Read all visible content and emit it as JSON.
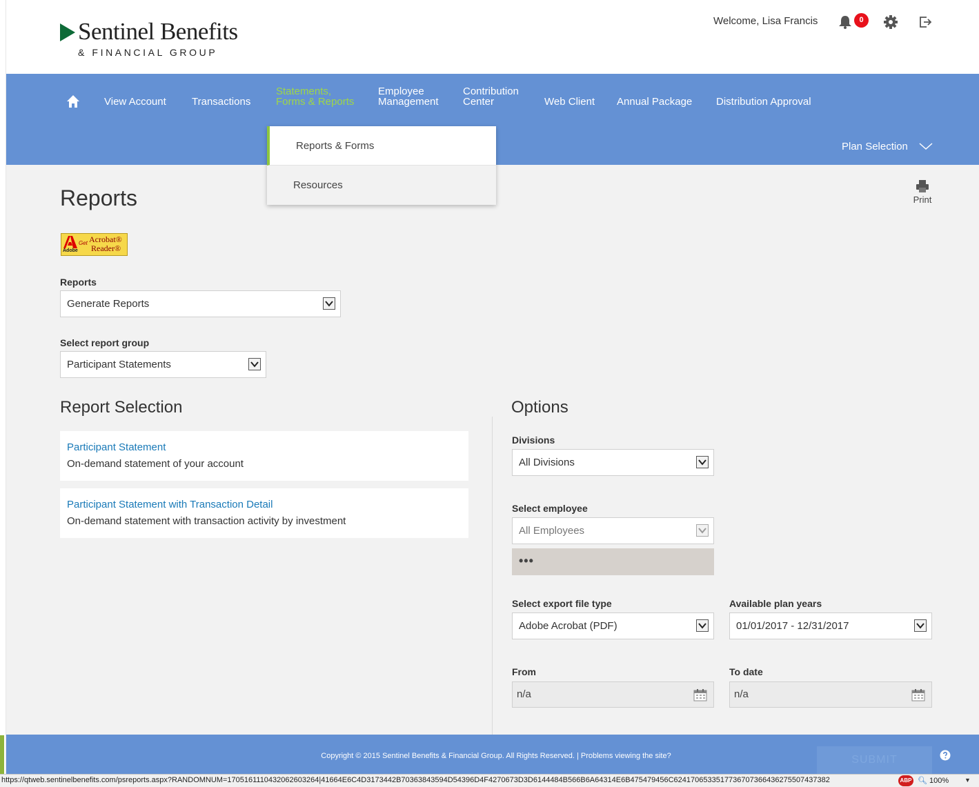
{
  "header": {
    "logo_name": "Sentinel Benefits",
    "logo_sub": "& FINANCIAL GROUP",
    "welcome": "Welcome,  Lisa Francis",
    "notification_count": "0"
  },
  "nav": {
    "items": [
      {
        "label": "View Account"
      },
      {
        "label": "Transactions"
      },
      {
        "label": "Statements,\nForms & Reports"
      },
      {
        "label": "Employee\nManagement"
      },
      {
        "label": "Contribution\nCenter"
      },
      {
        "label": "Web Client"
      },
      {
        "label": "Annual Package"
      },
      {
        "label": "Distribution Approval"
      }
    ],
    "plan_selection": "Plan Selection"
  },
  "dropdown": {
    "items": [
      "Reports & Forms",
      "Resources"
    ]
  },
  "page": {
    "title": "Reports",
    "print_label": "Print",
    "acrobat": {
      "adobe": "Adobe",
      "get": "Get",
      "line1": "Acrobat",
      "line2": "Reader"
    }
  },
  "form": {
    "reports_label": "Reports",
    "reports_value": "Generate Reports",
    "report_group_label": "Select report group",
    "report_group_value": "Participant Statements"
  },
  "report_selection": {
    "title": "Report Selection",
    "items": [
      {
        "name": "Participant Statement",
        "desc": "On-demand statement of your account"
      },
      {
        "name": "Participant Statement with Transaction Detail",
        "desc": "On-demand statement with transaction activity by investment"
      }
    ]
  },
  "options": {
    "title": "Options",
    "divisions_label": "Divisions",
    "divisions_value": "All Divisions",
    "employee_label": "Select employee",
    "employee_value": "All Employees",
    "employee_dots": "•••",
    "export_label": "Select export file type",
    "export_value": "Adobe Acrobat (PDF)",
    "plan_years_label": "Available plan years",
    "plan_years_value": "01/01/2017 - 12/31/2017",
    "from_label": "From",
    "from_value": "n/a",
    "to_label": "To date",
    "to_value": "n/a"
  },
  "footer": {
    "copyright": "Copyright © 2015 Sentinel Benefits & Financial Group. All Rights Reserved. | Problems viewing the site?",
    "submit": "SUBMIT"
  },
  "statusbar": {
    "url": "https://qtweb.sentinelbenefits.com/psreports.aspx?RANDOMNUM=1705161110432062603264|41664E6C4D3173442B70363843594D54396D4F4270673D3D6144484B566B6A64314E6B475479456C6241706533517736707366436275507437382",
    "abp": "ABP",
    "zoom": "100%"
  },
  "colors": {
    "nav_bg": "#6491d4",
    "nav_active": "#9ed648",
    "link": "#1a7ab8",
    "badge": "#e8111b",
    "page_bg": "#f2f2f2"
  }
}
